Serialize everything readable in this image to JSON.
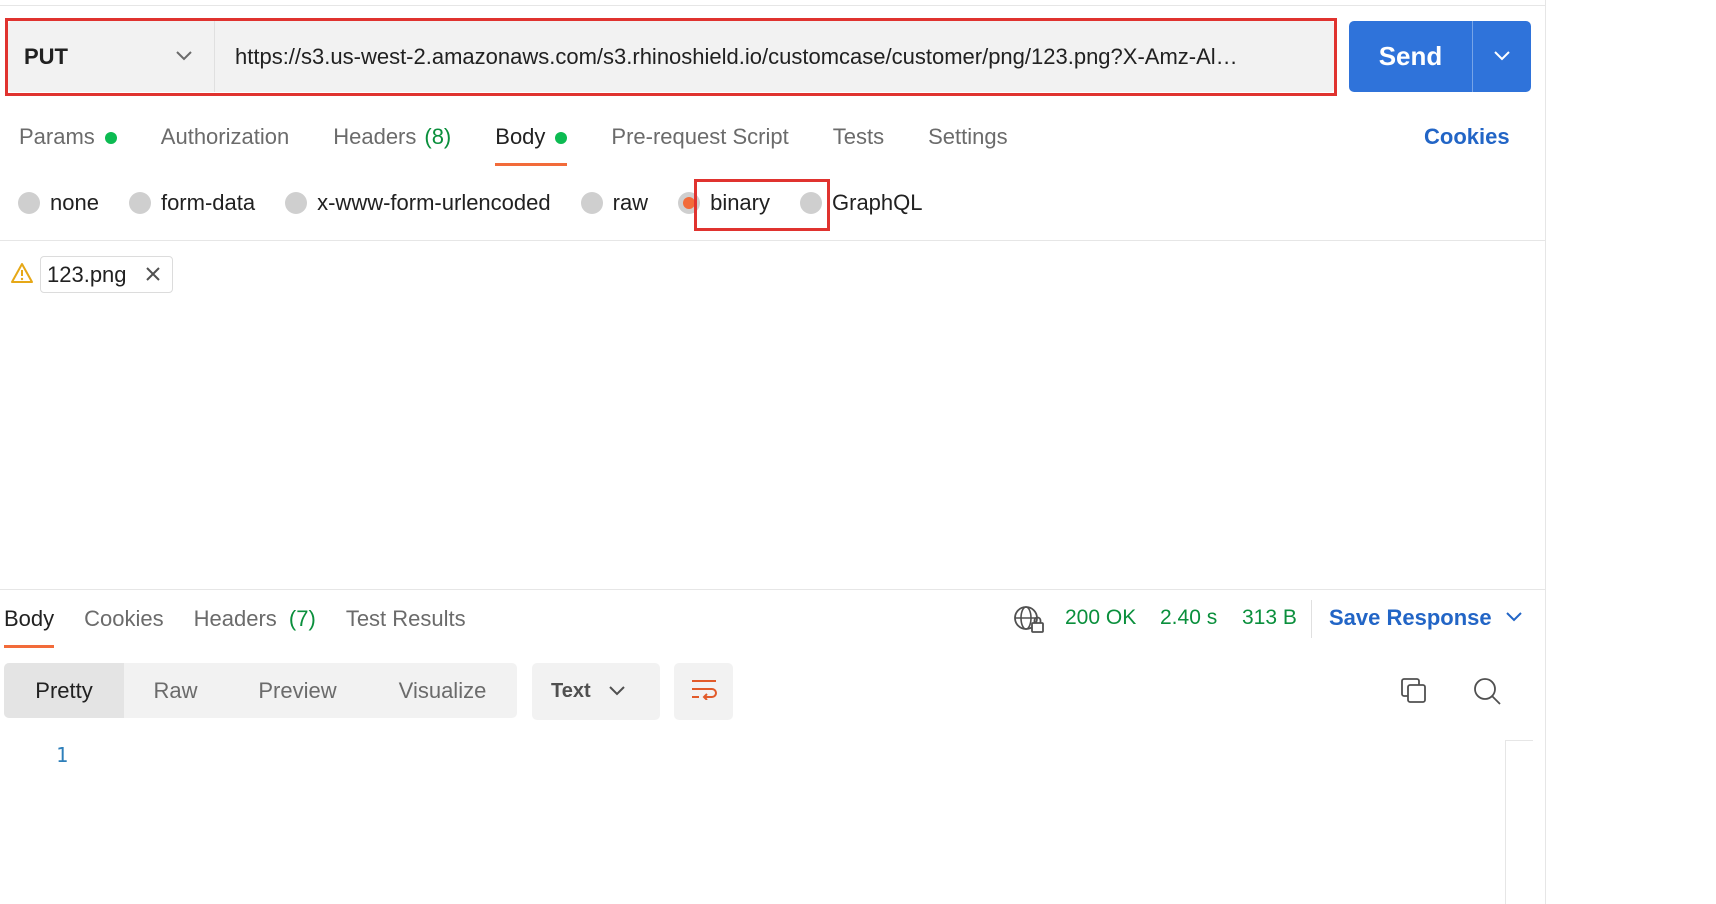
{
  "request": {
    "method": "PUT",
    "url": "https://s3.us-west-2.amazonaws.com/s3.rhinoshield.io/customcase/customer/png/123.png?X-Amz-Al…",
    "send_label": "Send"
  },
  "tabs": [
    {
      "label": "Params",
      "dot": true
    },
    {
      "label": "Authorization"
    },
    {
      "label": "Headers",
      "count": "(8)"
    },
    {
      "label": "Body",
      "dot": true,
      "active": true
    },
    {
      "label": "Pre-request Script"
    },
    {
      "label": "Tests"
    },
    {
      "label": "Settings"
    }
  ],
  "cookies_label": "Cookies",
  "body_types": [
    {
      "label": "none"
    },
    {
      "label": "form-data"
    },
    {
      "label": "x-www-form-urlencoded"
    },
    {
      "label": "raw"
    },
    {
      "label": "binary",
      "selected": true
    },
    {
      "label": "GraphQL"
    }
  ],
  "file": {
    "name": "123.png",
    "icon": "warning-icon"
  },
  "response": {
    "tabs": [
      {
        "label": "Body",
        "active": true
      },
      {
        "label": "Cookies"
      },
      {
        "label": "Headers",
        "count": "(7)"
      },
      {
        "label": "Test Results"
      }
    ],
    "status": "200 OK",
    "time": "2.40 s",
    "size": "313 B",
    "save_label": "Save Response",
    "views": [
      "Pretty",
      "Raw",
      "Preview",
      "Visualize"
    ],
    "format": "Text",
    "line_number": "1"
  },
  "colors": {
    "accent": "#f26b3a",
    "send": "#2f73da",
    "link": "#2265c6",
    "success": "#0a8f3c",
    "annotation": "#e0332f"
  }
}
